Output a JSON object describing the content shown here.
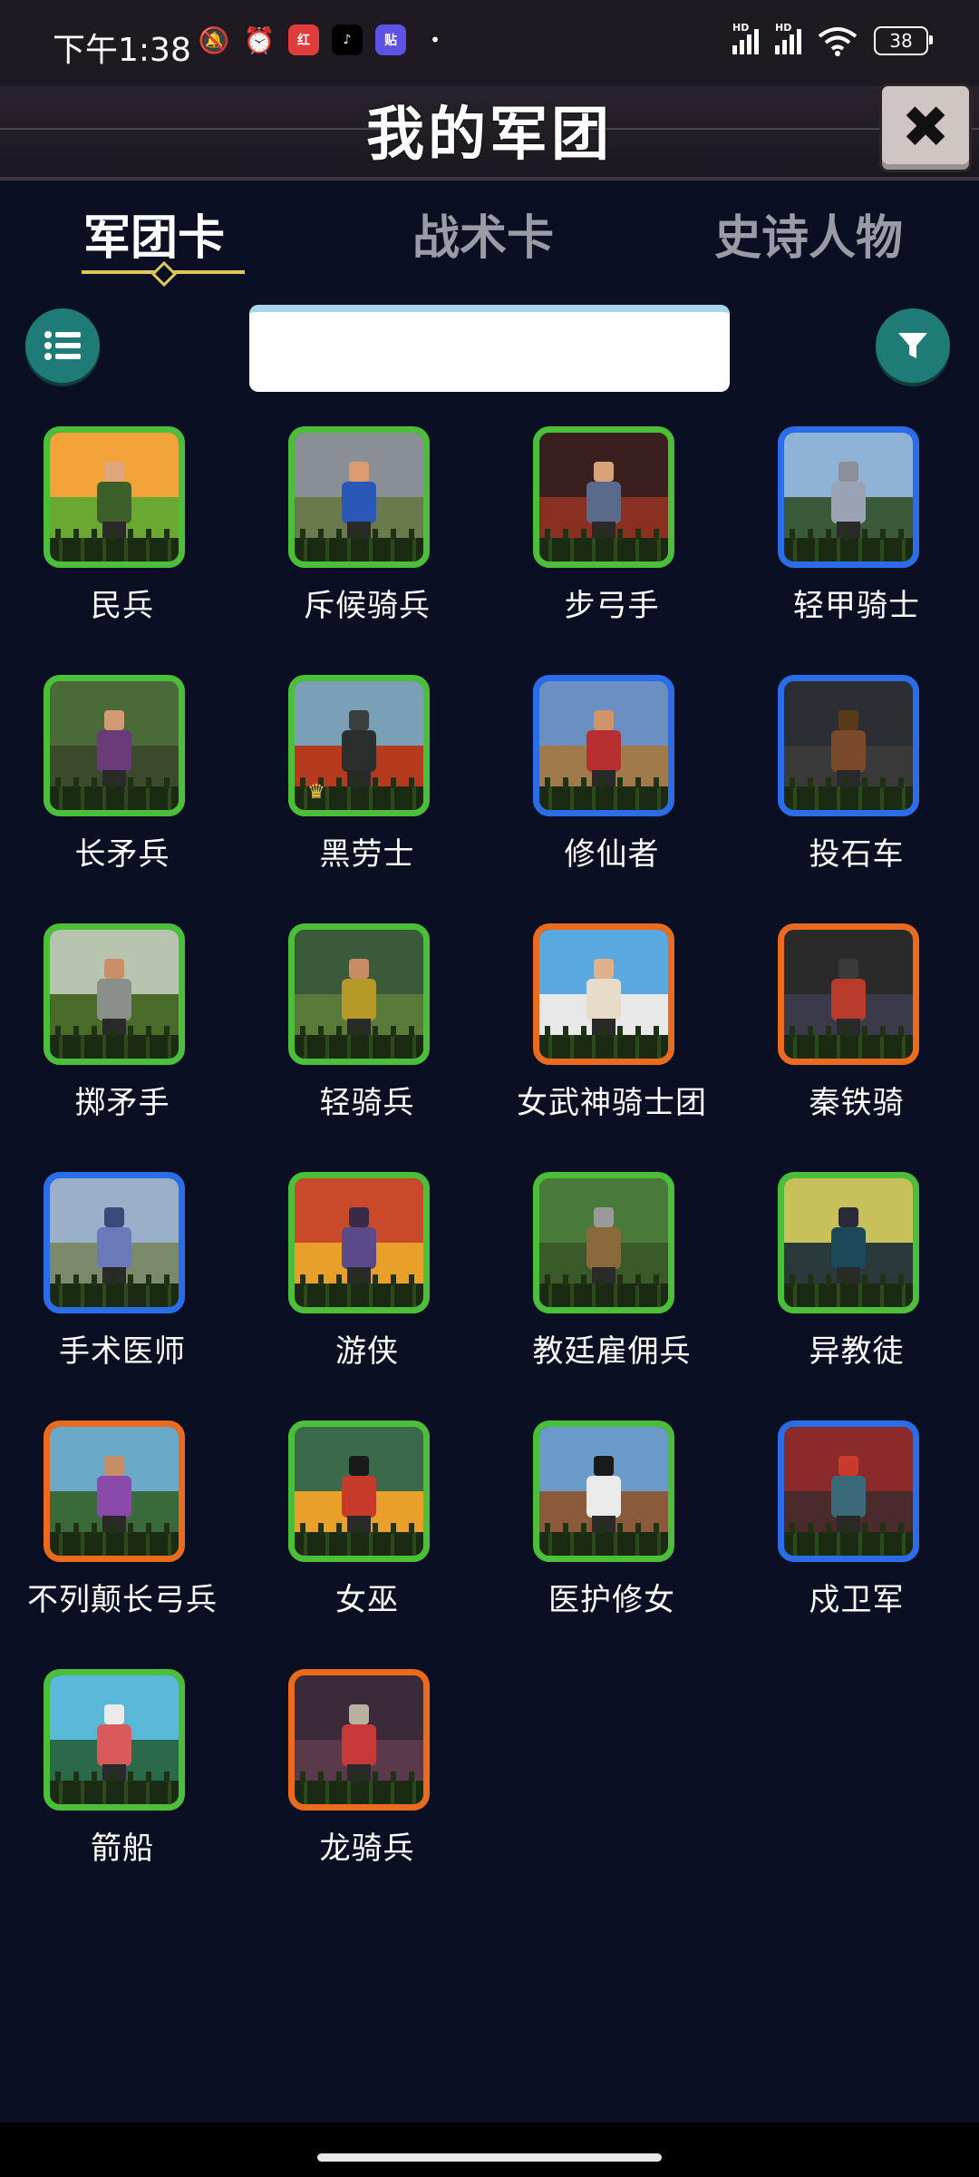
{
  "status_bar": {
    "time": "下午1:38",
    "battery": "38",
    "app_badges": [
      {
        "text": "红",
        "color": "#e13c3c"
      },
      {
        "text": "♪",
        "color": "#000000"
      },
      {
        "text": "贴",
        "color": "#5e52e6"
      }
    ]
  },
  "header": {
    "title": "我的军团",
    "close_icon": "close-icon"
  },
  "tabs": [
    {
      "label": "军团卡",
      "active": true
    },
    {
      "label": "战术卡",
      "active": false
    },
    {
      "label": "史诗人物",
      "active": false
    }
  ],
  "search": {
    "value": "",
    "placeholder": ""
  },
  "colors": {
    "green": "#4bbf3a",
    "blue": "#2b6de8",
    "orange": "#ea6a1e",
    "accent_teal": "#1f7b76",
    "tab_underline": "#e0c85a"
  },
  "units": [
    {
      "name": "民兵",
      "rarity": "green",
      "sky": "#f2a33a",
      "ground": "#6aa832",
      "body": "#3d5f2a",
      "head": "#e0a77a"
    },
    {
      "name": "斥候骑兵",
      "rarity": "green",
      "sky": "#8a8f96",
      "ground": "#6a7a4c",
      "body": "#2b58b8",
      "head": "#d99b6f"
    },
    {
      "name": "步弓手",
      "rarity": "green",
      "sky": "#3a1f1f",
      "ground": "#8a3020",
      "body": "#5a6a8a",
      "head": "#d7a17a"
    },
    {
      "name": "轻甲骑士",
      "rarity": "blue",
      "sky": "#8fb3d6",
      "ground": "#3a5a3a",
      "body": "#9aa3b3",
      "head": "#8a8f99"
    },
    {
      "name": "长矛兵",
      "rarity": "green",
      "sky": "#4a6a3a",
      "ground": "#3a4a2a",
      "body": "#6a3a7a",
      "head": "#d19a72"
    },
    {
      "name": "黑劳士",
      "rarity": "green",
      "sky": "#7aa0b8",
      "ground": "#b53a1e",
      "body": "#2a2f2d",
      "head": "#3a3f3d",
      "crown": true
    },
    {
      "name": "修仙者",
      "rarity": "blue",
      "sky": "#6a8fc0",
      "ground": "#a07a4a",
      "body": "#b82f2f",
      "head": "#d0936a"
    },
    {
      "name": "投石车",
      "rarity": "blue",
      "sky": "#2b2f33",
      "ground": "#3a3a3a",
      "body": "#7a4a2a",
      "head": "#5a3a1a"
    },
    {
      "name": "掷矛手",
      "rarity": "green",
      "sky": "#b8c4b0",
      "ground": "#4a6a2a",
      "body": "#8a8f8a",
      "head": "#c99068"
    },
    {
      "name": "轻骑兵",
      "rarity": "green",
      "sky": "#3a5a3a",
      "ground": "#5a7a3a",
      "body": "#b59a2a",
      "head": "#c88b63"
    },
    {
      "name": "女武神骑士团",
      "rarity": "orange",
      "sky": "#5aa8e0",
      "ground": "#e8e8e8",
      "body": "#e6dcc8",
      "head": "#e0b08a"
    },
    {
      "name": "秦铁骑",
      "rarity": "orange",
      "sky": "#2a2a2a",
      "ground": "#3a3a4a",
      "body": "#b83a2a",
      "head": "#3a3a3a"
    },
    {
      "name": "手术医师",
      "rarity": "blue",
      "sky": "#9ab0c8",
      "ground": "#7a8a6a",
      "body": "#6a7ab8",
      "head": "#3a4a7a"
    },
    {
      "name": "游侠",
      "rarity": "green",
      "sky": "#c84a2a",
      "ground": "#e8a02a",
      "body": "#5a4a8a",
      "head": "#3a2a4a"
    },
    {
      "name": "教廷雇佣兵",
      "rarity": "green",
      "sky": "#4a7a3a",
      "ground": "#3a5a2a",
      "body": "#8a6a3a",
      "head": "#9a9a9a"
    },
    {
      "name": "异教徒",
      "rarity": "green",
      "sky": "#c8c05a",
      "ground": "#2a3a3a",
      "body": "#1a4a5a",
      "head": "#2a2a3a"
    },
    {
      "name": "不列颠长弓兵",
      "rarity": "orange",
      "sky": "#6aaac8",
      "ground": "#3a6a3a",
      "body": "#8a4aaa",
      "head": "#c88f67"
    },
    {
      "name": "女巫",
      "rarity": "green",
      "sky": "#3a6a4a",
      "ground": "#e8a02a",
      "body": "#c83a2a",
      "head": "#1a1a1a"
    },
    {
      "name": "医护修女",
      "rarity": "green",
      "sky": "#6a9ac8",
      "ground": "#8a5a3a",
      "body": "#eaeaea",
      "head": "#1a1a1a"
    },
    {
      "name": "戍卫军",
      "rarity": "blue",
      "sky": "#8a2a2a",
      "ground": "#4a2a2a",
      "body": "#3a6a7a",
      "head": "#c83a2a"
    },
    {
      "name": "箭船",
      "rarity": "green",
      "sky": "#5ab8d8",
      "ground": "#2a6a4a",
      "body": "#d85a5a",
      "head": "#eaeaea"
    },
    {
      "name": "龙骑兵",
      "rarity": "orange",
      "sky": "#3a2a3a",
      "ground": "#5a3a4a",
      "body": "#c83a3a",
      "head": "#b8b0a0"
    }
  ]
}
